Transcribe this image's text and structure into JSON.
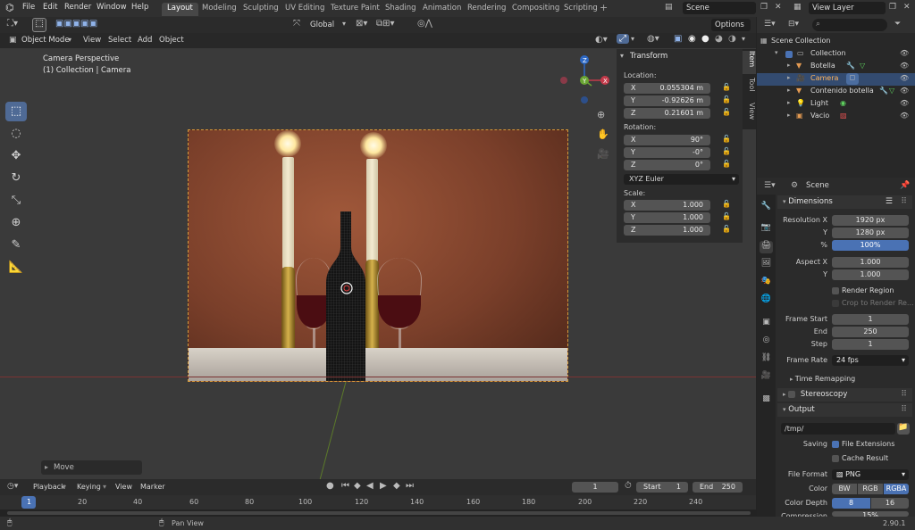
{
  "topbar": {
    "menus": [
      "File",
      "Edit",
      "Render",
      "Window",
      "Help"
    ],
    "workspace_tabs": [
      "Layout",
      "Modeling",
      "Sculpting",
      "UV Editing",
      "Texture Paint",
      "Shading",
      "Animation",
      "Rendering",
      "Compositing",
      "Scripting"
    ],
    "active_tab": "Layout",
    "scene": "Scene",
    "view_layer": "View Layer"
  },
  "viewport_header": {
    "transform_orientation": "Global",
    "options": "Options",
    "mode": "Object Mode",
    "menus": [
      "View",
      "Select",
      "Add",
      "Object"
    ]
  },
  "viewport": {
    "camera_perspective": "Camera Perspective",
    "collection_info": "(1) Collection | Camera",
    "last_operator": "Move"
  },
  "npanel": {
    "title": "Transform",
    "location_label": "Location:",
    "location": [
      {
        "axis": "X",
        "value": "0.055304 m"
      },
      {
        "axis": "Y",
        "value": "-0.92626 m"
      },
      {
        "axis": "Z",
        "value": "0.21601 m"
      }
    ],
    "rotation_label": "Rotation:",
    "rotation": [
      {
        "axis": "X",
        "value": "90°"
      },
      {
        "axis": "Y",
        "value": "-0°"
      },
      {
        "axis": "Z",
        "value": "0°"
      }
    ],
    "rotation_mode": "XYZ Euler",
    "scale_label": "Scale:",
    "scale": [
      {
        "axis": "X",
        "value": "1.000"
      },
      {
        "axis": "Y",
        "value": "1.000"
      },
      {
        "axis": "Z",
        "value": "1.000"
      }
    ],
    "tabs": [
      "Item",
      "Tool",
      "View"
    ]
  },
  "outliner": {
    "root": "Scene Collection",
    "items": [
      "Collection",
      "Botella",
      "Camera",
      "Contenido botella",
      "Light",
      "Vacio"
    ]
  },
  "properties": {
    "scene_name": "Scene",
    "dimensions_title": "Dimensions",
    "resolution_x_label": "Resolution X",
    "resolution_x": "1920 px",
    "resolution_y_label": "Y",
    "resolution_y": "1280 px",
    "resolution_pct_label": "%",
    "resolution_pct": "100%",
    "aspect_x_label": "Aspect X",
    "aspect_x": "1.000",
    "aspect_y_label": "Y",
    "aspect_y": "1.000",
    "render_region": "Render Region",
    "crop_region": "Crop to Render Re...",
    "frame_start_label": "Frame Start",
    "frame_start": "1",
    "frame_end_label": "End",
    "frame_end": "250",
    "frame_step_label": "Step",
    "frame_step": "1",
    "frame_rate_label": "Frame Rate",
    "frame_rate": "24 fps",
    "time_remapping": "Time Remapping",
    "stereoscopy": "Stereoscopy",
    "output_title": "Output",
    "output_path": "/tmp/",
    "saving_label": "Saving",
    "file_extensions": "File Extensions",
    "cache_result": "Cache Result",
    "file_format_label": "File Format",
    "file_format": "PNG",
    "color_label": "Color",
    "color_options": [
      "BW",
      "RGB",
      "RGBA"
    ],
    "color_selected": "RGBA",
    "color_depth_label": "Color Depth",
    "color_depth_options": [
      "8",
      "16"
    ],
    "compression_label": "Compression",
    "compression": "15%"
  },
  "timeline": {
    "menus": [
      "Playback",
      "Keying",
      "View",
      "Marker"
    ],
    "current_frame": "1",
    "start_label": "Start",
    "start": "1",
    "end_label": "End",
    "end": "250",
    "ruler_ticks": [
      "1",
      "20",
      "40",
      "60",
      "80",
      "100",
      "120",
      "140",
      "160",
      "180",
      "200",
      "220",
      "240"
    ]
  },
  "statusbar": {
    "pan_view": "Pan View",
    "version": "2.90.1"
  }
}
